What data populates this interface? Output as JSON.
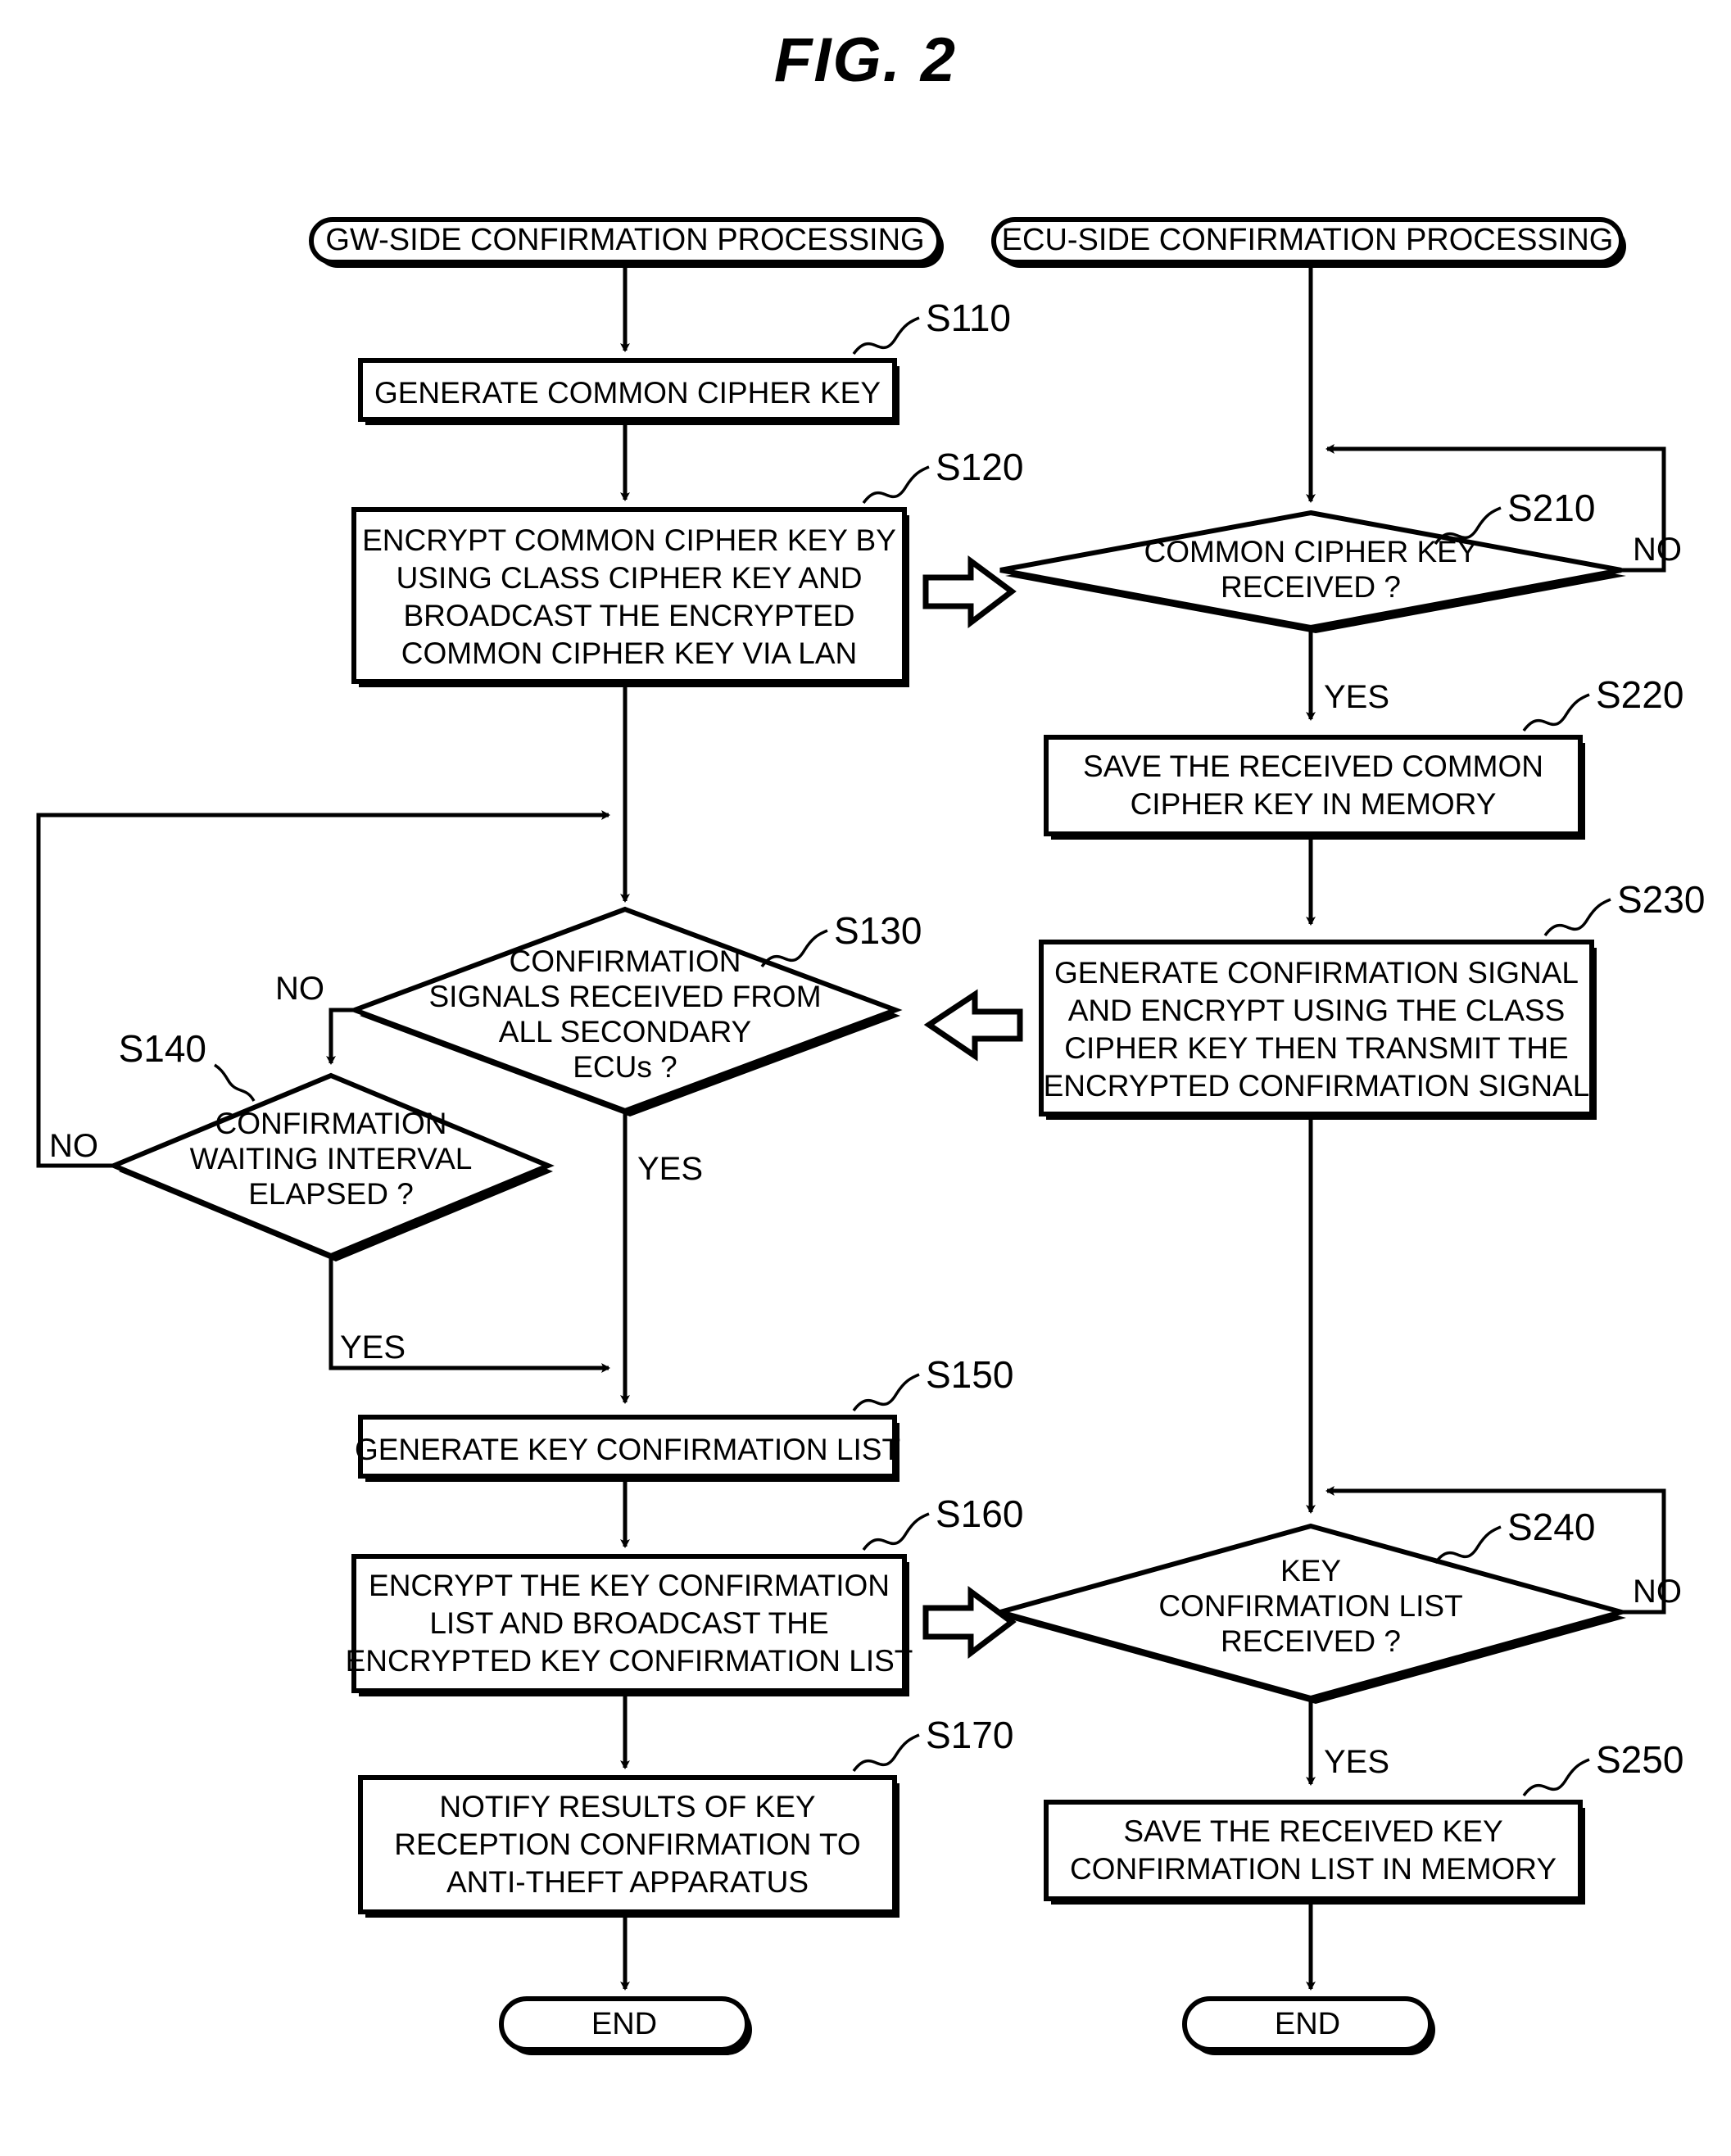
{
  "figure": {
    "title": "FIG.  2",
    "type": "flowchart",
    "columns": [
      {
        "id": "gw",
        "start_label": "GW-SIDE CONFIRMATION PROCESSING"
      },
      {
        "id": "ecu",
        "start_label": "ECU-SIDE CONFIRMATION PROCESSING"
      }
    ]
  },
  "gw": {
    "start": "GW-SIDE CONFIRMATION PROCESSING",
    "s110": {
      "id": "S110",
      "text": [
        "GENERATE COMMON CIPHER KEY"
      ]
    },
    "s120": {
      "id": "S120",
      "text": [
        "ENCRYPT COMMON CIPHER KEY BY",
        "USING CLASS CIPHER KEY AND",
        "BROADCAST THE ENCRYPTED",
        "COMMON CIPHER KEY VIA LAN"
      ]
    },
    "s130": {
      "id": "S130",
      "text": [
        "CONFIRMATION",
        "SIGNALS RECEIVED FROM",
        "ALL SECONDARY",
        "ECUs ?"
      ],
      "yes": "YES",
      "no": "NO"
    },
    "s140": {
      "id": "S140",
      "text": [
        "CONFIRMATION",
        "WAITING INTERVAL",
        "ELAPSED ?"
      ],
      "yes": "YES",
      "no": "NO"
    },
    "s150": {
      "id": "S150",
      "text": [
        "GENERATE KEY CONFIRMATION LIST"
      ]
    },
    "s160": {
      "id": "S160",
      "text": [
        "ENCRYPT THE KEY CONFIRMATION",
        "LIST AND BROADCAST THE",
        "ENCRYPTED KEY CONFIRMATION LIST"
      ]
    },
    "s170": {
      "id": "S170",
      "text": [
        "NOTIFY RESULTS OF KEY",
        "RECEPTION CONFIRMATION TO",
        "ANTI-THEFT APPARATUS"
      ]
    },
    "end": "END"
  },
  "ecu": {
    "start": "ECU-SIDE CONFIRMATION PROCESSING",
    "s210": {
      "id": "S210",
      "text": [
        "COMMON CIPHER KEY",
        "RECEIVED ?"
      ],
      "yes": "YES",
      "no": "NO"
    },
    "s220": {
      "id": "S220",
      "text": [
        "SAVE THE RECEIVED COMMON",
        "CIPHER KEY IN MEMORY"
      ]
    },
    "s230": {
      "id": "S230",
      "text": [
        "GENERATE CONFIRMATION SIGNAL",
        "AND ENCRYPT USING THE CLASS",
        "CIPHER KEY THEN TRANSMIT THE",
        "ENCRYPTED CONFIRMATION SIGNAL"
      ]
    },
    "s240": {
      "id": "S240",
      "text": [
        "KEY",
        "CONFIRMATION LIST",
        "RECEIVED ?"
      ],
      "yes": "YES",
      "no": "NO"
    },
    "s250": {
      "id": "S250",
      "text": [
        "SAVE THE RECEIVED KEY",
        "CONFIRMATION LIST IN MEMORY"
      ]
    },
    "end": "END"
  },
  "interconnects": [
    {
      "name": "block-arrow-s120-to-s210",
      "direction": "right"
    },
    {
      "name": "block-arrow-s230-to-s130",
      "direction": "left"
    },
    {
      "name": "block-arrow-s160-to-s240",
      "direction": "right"
    }
  ],
  "colors": {
    "ink": "#000000",
    "paper": "#ffffff"
  }
}
